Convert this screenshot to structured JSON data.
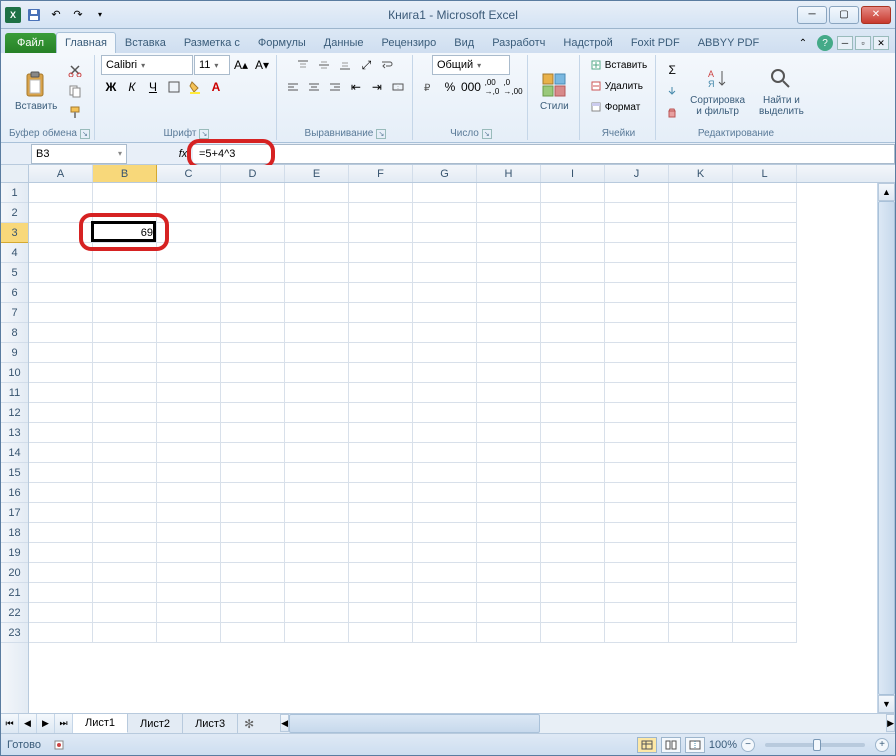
{
  "title": "Книга1 - Microsoft Excel",
  "qat": {
    "save": "💾",
    "undo": "↶",
    "redo": "↷"
  },
  "tabs": {
    "file": "Файл",
    "items": [
      "Главная",
      "Вставка",
      "Разметка с",
      "Формулы",
      "Данные",
      "Рецензиро",
      "Вид",
      "Разработч",
      "Надстрой",
      "Foxit PDF",
      "ABBYY PDF"
    ],
    "active": 0
  },
  "ribbon": {
    "clipboard": {
      "label": "Буфер обмена",
      "paste": "Вставить"
    },
    "font": {
      "label": "Шрифт",
      "name": "Calibri",
      "size": "11",
      "bold": "Ж",
      "italic": "К",
      "underline": "Ч"
    },
    "align": {
      "label": "Выравнивание"
    },
    "number": {
      "label": "Число",
      "format": "Общий"
    },
    "styles": {
      "label": "Стили",
      "btn": "Стили"
    },
    "cells": {
      "label": "Ячейки",
      "insert": "Вставить",
      "delete": "Удалить",
      "format": "Формат"
    },
    "editing": {
      "label": "Редактирование",
      "sort": "Сортировка\nи фильтр",
      "find": "Найти и\nвыделить"
    }
  },
  "formula_bar": {
    "cell_ref": "B3",
    "fx": "fx",
    "formula": "=5+4^3"
  },
  "grid": {
    "columns": [
      "A",
      "B",
      "C",
      "D",
      "E",
      "F",
      "G",
      "H",
      "I",
      "J",
      "K",
      "L"
    ],
    "row_count": 23,
    "active_col": 1,
    "active_row": 2,
    "cells": {
      "B3": "69"
    }
  },
  "sheets": {
    "tabs": [
      "Лист1",
      "Лист2",
      "Лист3"
    ],
    "active": 0
  },
  "status": {
    "ready": "Готово",
    "zoom": "100%"
  }
}
